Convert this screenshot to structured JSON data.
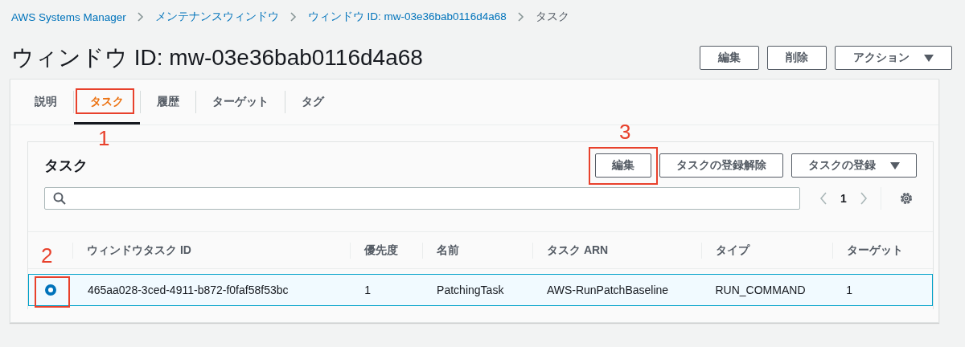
{
  "breadcrumb": [
    {
      "label": "AWS Systems Manager"
    },
    {
      "label": "メンテナンスウィンドウ"
    },
    {
      "label": "ウィンドウ ID: mw-03e36bab0116d4a68"
    },
    {
      "label": "タスク"
    }
  ],
  "title": "ウィンドウ ID: mw-03e36bab0116d4a68",
  "header_buttons": [
    {
      "label": "編集",
      "kind": "plain"
    },
    {
      "label": "削除",
      "kind": "plain"
    },
    {
      "label": "アクション",
      "kind": "dropdown"
    }
  ],
  "tabs": [
    {
      "label": "説明",
      "selected": false
    },
    {
      "label": "タスク",
      "selected": true,
      "annotation": "1"
    },
    {
      "label": "履歴",
      "selected": false
    },
    {
      "label": "ターゲット",
      "selected": false
    },
    {
      "label": "タグ",
      "selected": false
    }
  ],
  "tasks": {
    "title": "タスク",
    "buttons": [
      {
        "label": "編集",
        "kind": "plain",
        "annotation": "3"
      },
      {
        "label": "タスクの登録解除",
        "kind": "plain"
      },
      {
        "label": "タスクの登録",
        "kind": "dropdown"
      }
    ],
    "page": "1",
    "columns": [
      "ウィンドウタスク ID",
      "優先度",
      "名前",
      "タスク ARN",
      "タイプ",
      "ターゲット"
    ],
    "select_annotation": "2",
    "rows": [
      {
        "selected": true,
        "cells": [
          "465aa028-3ced-4911-b872-f0faf58f53bc",
          "1",
          "PatchingTask",
          "AWS-RunPatchBaseline",
          "RUN_COMMAND",
          "1"
        ]
      }
    ]
  }
}
